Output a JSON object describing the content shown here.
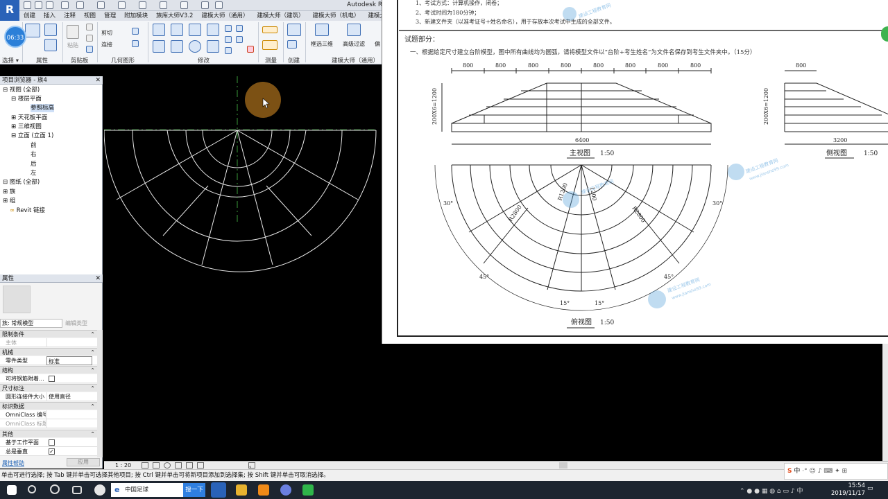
{
  "app": {
    "title": "Autodesk Re",
    "icon_letter": "R"
  },
  "tabs": [
    "创建",
    "插入",
    "注释",
    "视图",
    "管理",
    "附加模块",
    "族库大师V3.2",
    "建模大师（通用）",
    "建模大师（建筑）",
    "建模大师（机电）",
    "建模大"
  ],
  "ribbon": {
    "avatar_time": "06:33",
    "panels": [
      "选择 ▾",
      "属性",
      "剪贴板",
      "几何图形",
      "修改",
      "测量",
      "创建",
      "建模大师（通用）"
    ],
    "labels": {
      "cut": "剪切",
      "join": "连接",
      "paste": "粘贴",
      "frame3d": "框选三维",
      "filter": "高级过滤",
      "extra": "偏"
    }
  },
  "project_browser": {
    "title": "项目浏览器 - 族4",
    "items": [
      "视图 (全部)",
      "楼层平面",
      "参照标高",
      "天花板平面",
      "三维视图",
      "立面 (立面 1)",
      "前",
      "右",
      "后",
      "左",
      "图纸 (全部)",
      "族",
      "组",
      "Revit 链接"
    ]
  },
  "properties": {
    "title": "属性",
    "family_type": "族: 常规模型",
    "edit_type": "编辑类型",
    "groups": {
      "constraints": "限制条件",
      "mechanical": "机械",
      "structure": "结构",
      "dimensions": "尺寸标注",
      "identity": "标识数据",
      "other": "其他"
    },
    "rows": {
      "host": "主体",
      "part_type": "零件类型",
      "part_type_val": "标准",
      "rebar": "可将钢筋附着...",
      "circle_size": "圆形连接件大小",
      "circle_size_val": "使用直径",
      "omni_no": "OmniClass 编号",
      "omni_title": "OmniClass 标题",
      "workplane": "基于工作平面",
      "always_vertical": "总是垂直"
    },
    "help": "属性帮助",
    "apply": "应用"
  },
  "view_bar": {
    "scale": "1 : 20"
  },
  "status_text": "单击可进行选择; 按 Tab 键并单击可选择其他项目; 按 Ctrl 键并单击可将新项目添加到选择集; 按 Shift 键并单击可取消选择。",
  "taskbar": {
    "search_text": "中国足球",
    "search_btn": "搜一下",
    "time": "15:54",
    "date": "2019/11/17",
    "ime": "中"
  },
  "document": {
    "line1": "1、考试方式：计算机操作，闭卷；",
    "line2": "2、考试时间为180分钟；",
    "line3": "3、新建文件夹（以准考证号+姓名命名），用于存放本次考试中生成的全部文件。",
    "section": "试题部分：",
    "question": "一、根据给定尺寸建立台阶模型，图中所有曲线均为圆弧，请将模型文件以“台阶+考生姓名”为文件名保存到考生文件夹中。（15分）",
    "dims_top": [
      "800",
      "800",
      "800",
      "800",
      "800",
      "800",
      "800",
      "800"
    ],
    "total_width": "6400",
    "height_label": "200X6=1200",
    "front_title": "主视图",
    "front_scale": "1:50",
    "side_dim": "800",
    "side_width": "3200",
    "side_title": "侧视图",
    "side_scale": "1:50",
    "top_title": "俯视图",
    "top_scale": "1:50",
    "radii": [
      "R2800",
      "R2800",
      "R1200",
      "1200"
    ],
    "angles": [
      "30°",
      "30°",
      "45°",
      "45°",
      "15°",
      "15°"
    ],
    "watermark": "建设工程教育网",
    "watermark_url": "www.jianshe99.com"
  }
}
